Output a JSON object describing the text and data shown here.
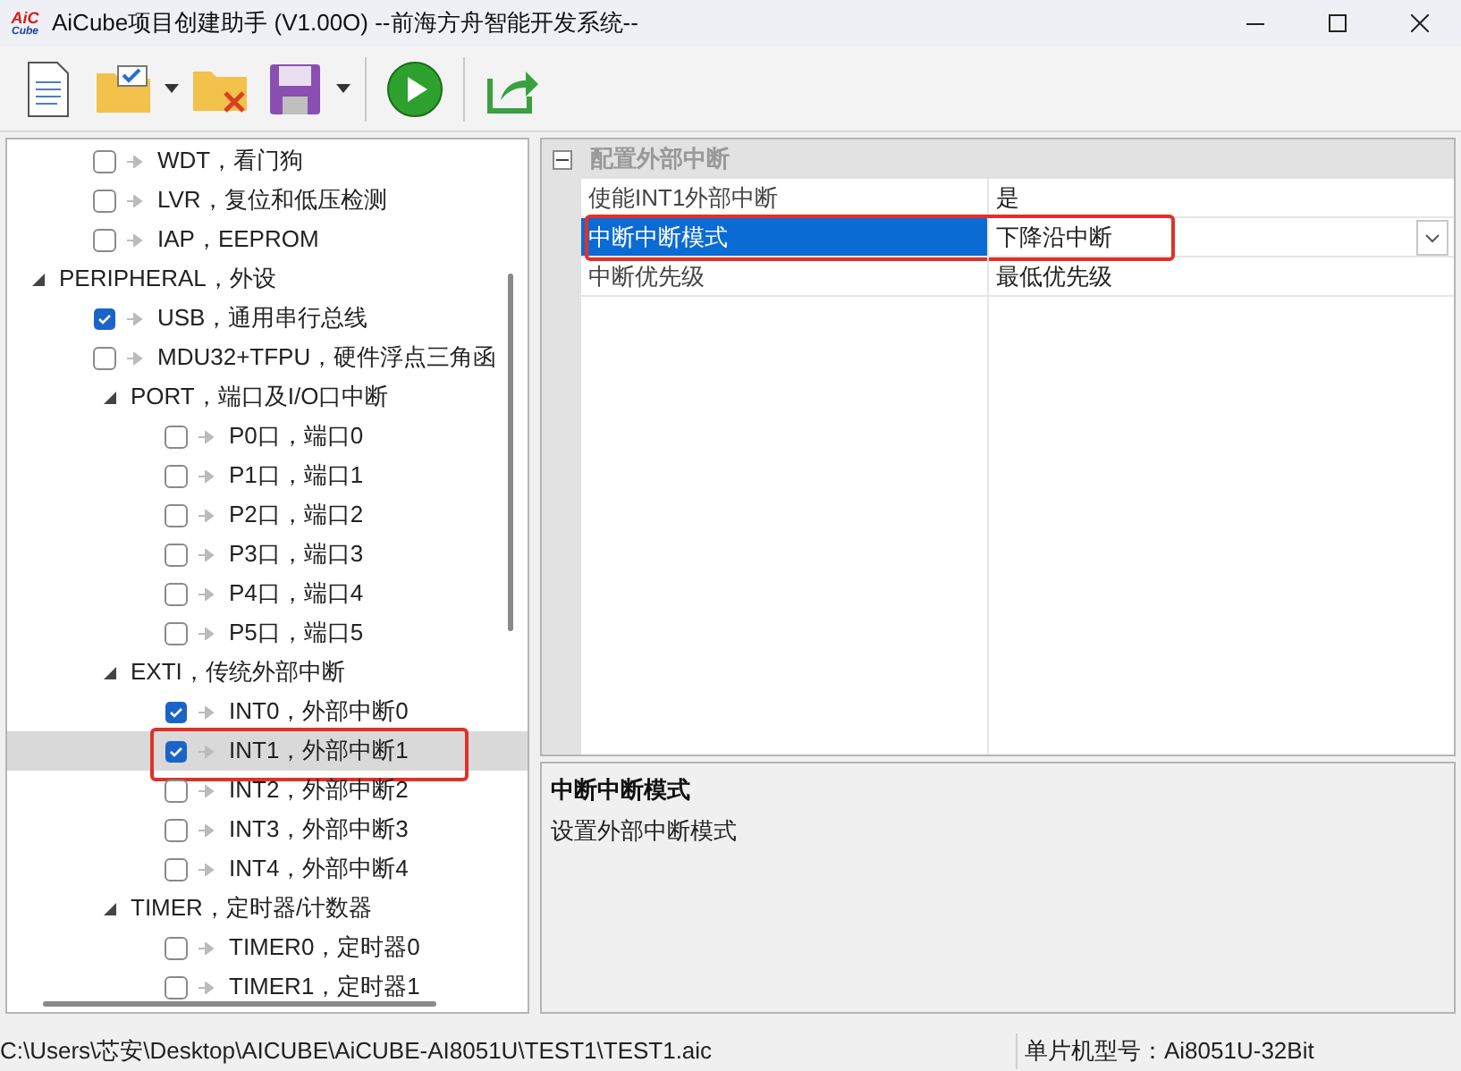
{
  "window": {
    "logo_top": "AiC",
    "logo_bottom": "Cube",
    "title": "AiCube项目创建助手 (V1.00O) --前海方舟智能开发系统--"
  },
  "toolbar": [
    {
      "kind": "new"
    },
    {
      "kind": "open",
      "dropdown": true
    },
    {
      "kind": "close"
    },
    {
      "kind": "save",
      "dropdown": true
    },
    {
      "kind": "separator"
    },
    {
      "kind": "run"
    },
    {
      "kind": "separator"
    },
    {
      "kind": "export"
    }
  ],
  "tree": [
    {
      "kind": "leaf",
      "label": "WDT，看门狗",
      "checked": false,
      "selected": false
    },
    {
      "kind": "leaf",
      "label": "LVR，复位和低压检测",
      "checked": false,
      "selected": false
    },
    {
      "kind": "leaf",
      "label": "IAP，EEPROM",
      "checked": false,
      "selected": false
    },
    {
      "kind": "group",
      "label": "PERIPHERAL，外设",
      "expanded": true,
      "children": [
        {
          "kind": "leaf",
          "label": "USB，通用串行总线",
          "checked": true,
          "selected": false
        },
        {
          "kind": "leaf",
          "label": "MDU32+TFPU，硬件浮点三角函",
          "checked": false,
          "selected": false
        },
        {
          "kind": "group",
          "label": "PORT，端口及I/O口中断",
          "expanded": true,
          "children": [
            {
              "kind": "leaf",
              "label": "P0口，端口0",
              "checked": false,
              "selected": false
            },
            {
              "kind": "leaf",
              "label": "P1口，端口1",
              "checked": false,
              "selected": false
            },
            {
              "kind": "leaf",
              "label": "P2口，端口2",
              "checked": false,
              "selected": false
            },
            {
              "kind": "leaf",
              "label": "P3口，端口3",
              "checked": false,
              "selected": false
            },
            {
              "kind": "leaf",
              "label": "P4口，端口4",
              "checked": false,
              "selected": false
            },
            {
              "kind": "leaf",
              "label": "P5口，端口5",
              "checked": false,
              "selected": false
            }
          ]
        },
        {
          "kind": "group",
          "label": "EXTI，传统外部中断",
          "expanded": true,
          "children": [
            {
              "kind": "leaf",
              "label": "INT0，外部中断0",
              "checked": true,
              "selected": false
            },
            {
              "kind": "leaf",
              "label": "INT1，外部中断1",
              "checked": true,
              "selected": true,
              "annotated": true
            },
            {
              "kind": "leaf",
              "label": "INT2，外部中断2",
              "checked": false,
              "selected": false
            },
            {
              "kind": "leaf",
              "label": "INT3，外部中断3",
              "checked": false,
              "selected": false
            },
            {
              "kind": "leaf",
              "label": "INT4，外部中断4",
              "checked": false,
              "selected": false
            }
          ]
        },
        {
          "kind": "group",
          "label": "TIMER，定时器/计数器",
          "expanded": true,
          "children": [
            {
              "kind": "leaf",
              "label": "TIMER0，定时器0",
              "checked": false,
              "selected": false
            },
            {
              "kind": "leaf",
              "label": "TIMER1，定时器1",
              "checked": false,
              "selected": false
            }
          ]
        }
      ]
    }
  ],
  "properties": {
    "category": {
      "label": "配置外部中断",
      "expanded": true
    },
    "rows": [
      {
        "name": "使能INT1外部中断",
        "value": "是",
        "selected": false,
        "dropdown": false
      },
      {
        "name": "中断中断模式",
        "value": "下降沿中断",
        "selected": true,
        "dropdown": true,
        "annotated": true
      },
      {
        "name": "中断优先级",
        "value": "最低优先级",
        "selected": false,
        "dropdown": false
      }
    ]
  },
  "description": {
    "title": "中断中断模式",
    "text": "设置外部中断模式"
  },
  "status_bar": {
    "path": "C:\\Users\\芯安\\Desktop\\AICUBE\\AiCUBE-AI8051U\\TEST1\\TEST1.aic",
    "chip": "单片机型号：Ai8051U-32Bit"
  }
}
